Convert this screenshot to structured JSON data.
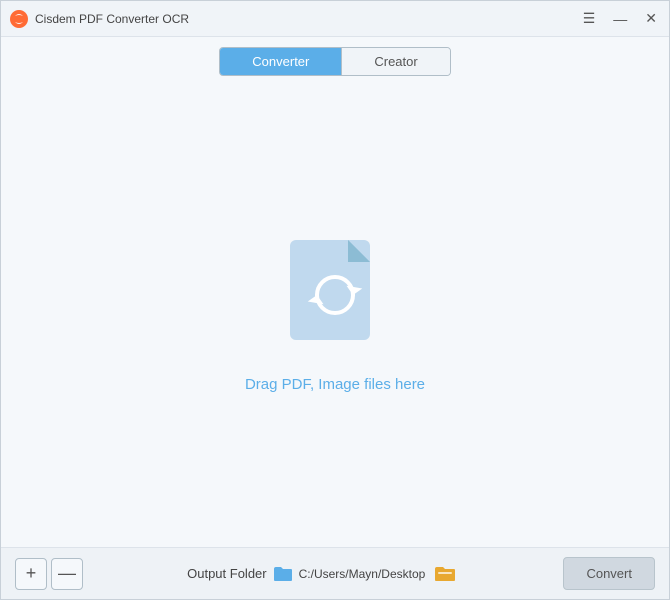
{
  "titleBar": {
    "appName": "Cisdem PDF Converter OCR",
    "controls": {
      "menu": "☰",
      "minimize": "—",
      "close": "✕"
    }
  },
  "tabs": {
    "converter": "Converter",
    "creator": "Creator",
    "activeTab": "converter"
  },
  "dropArea": {
    "hint": "Drag PDF, Image files here"
  },
  "bottomBar": {
    "addButton": "+",
    "removeButton": "—",
    "outputFolderLabel": "Output Folder",
    "outputPath": "C:/Users/Mayn/Desktop",
    "convertButton": "Convert"
  }
}
